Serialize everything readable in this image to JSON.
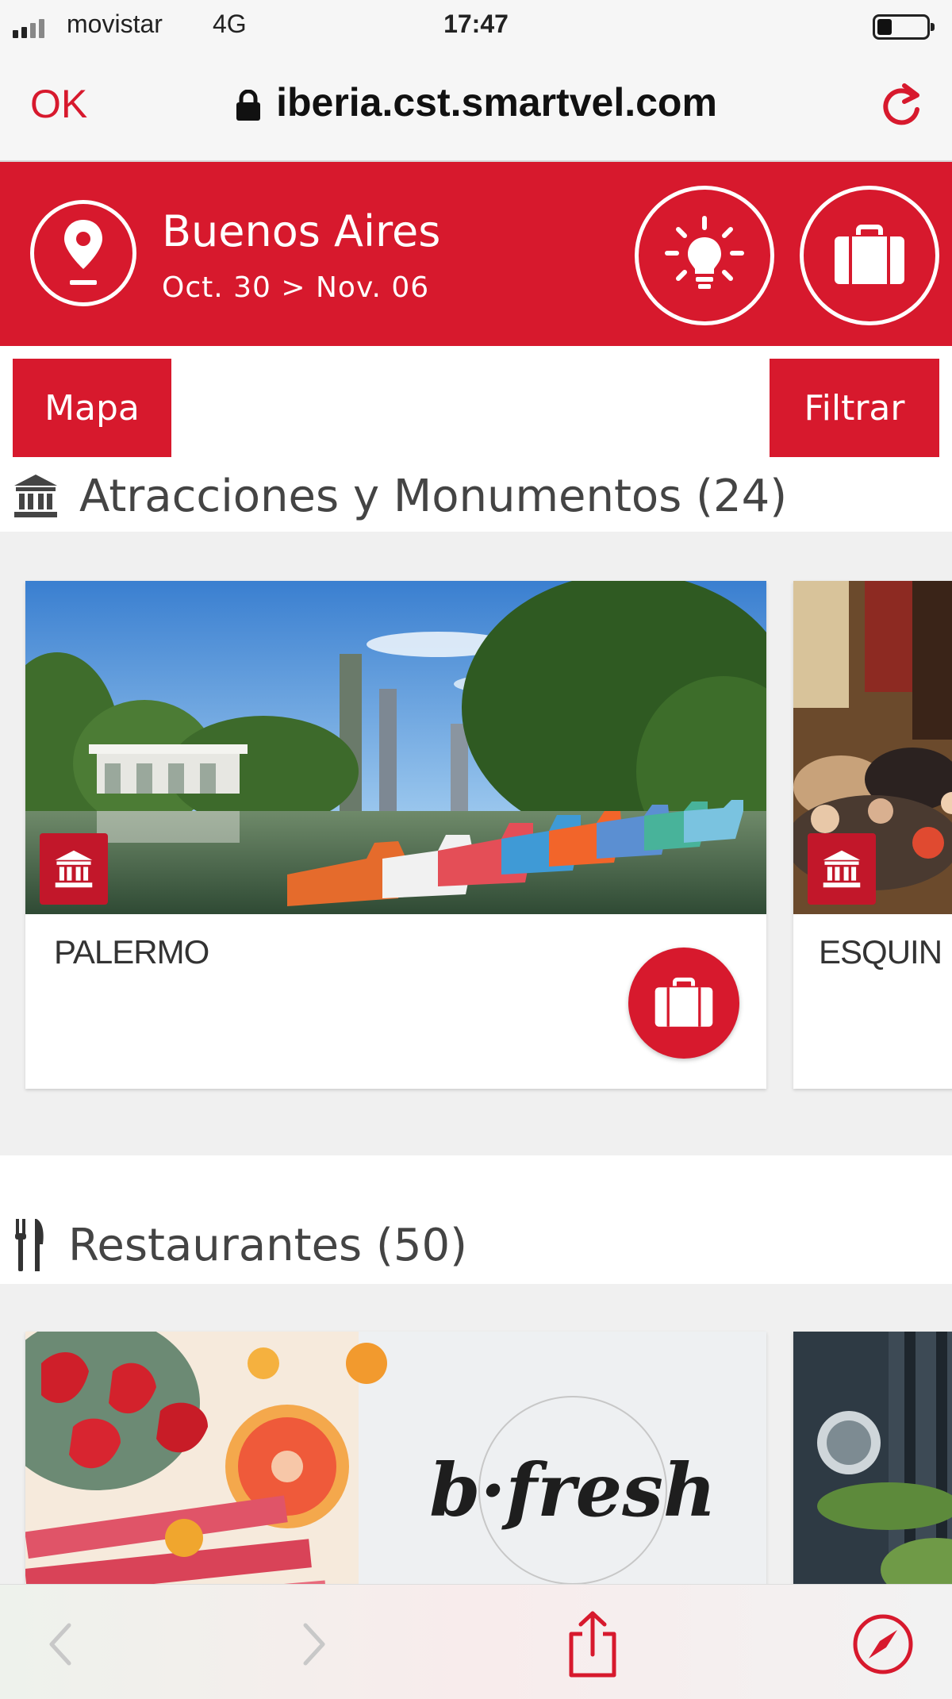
{
  "status_bar": {
    "carrier": "movistar",
    "network": "4G",
    "time": "17:47"
  },
  "browser": {
    "done_label": "OK",
    "url": "iberia.cst.smartvel.com"
  },
  "header": {
    "city": "Buenos Aires",
    "dates": "Oct. 30 > Nov. 06"
  },
  "actions": {
    "map_label": "Mapa",
    "filter_label": "Filtrar"
  },
  "sections": [
    {
      "title": "Atracciones y Monumentos (24)",
      "icon": "monument-icon",
      "cards": [
        {
          "name": "PALERMO"
        },
        {
          "name": "ESQUIN"
        }
      ]
    },
    {
      "title": "Restaurantes (50)",
      "icon": "cutlery-icon",
      "cards": [
        {
          "logo_text": "b·fresh"
        }
      ]
    }
  ],
  "colors": {
    "brand_red": "#d7192d",
    "text_gray": "#444444"
  }
}
